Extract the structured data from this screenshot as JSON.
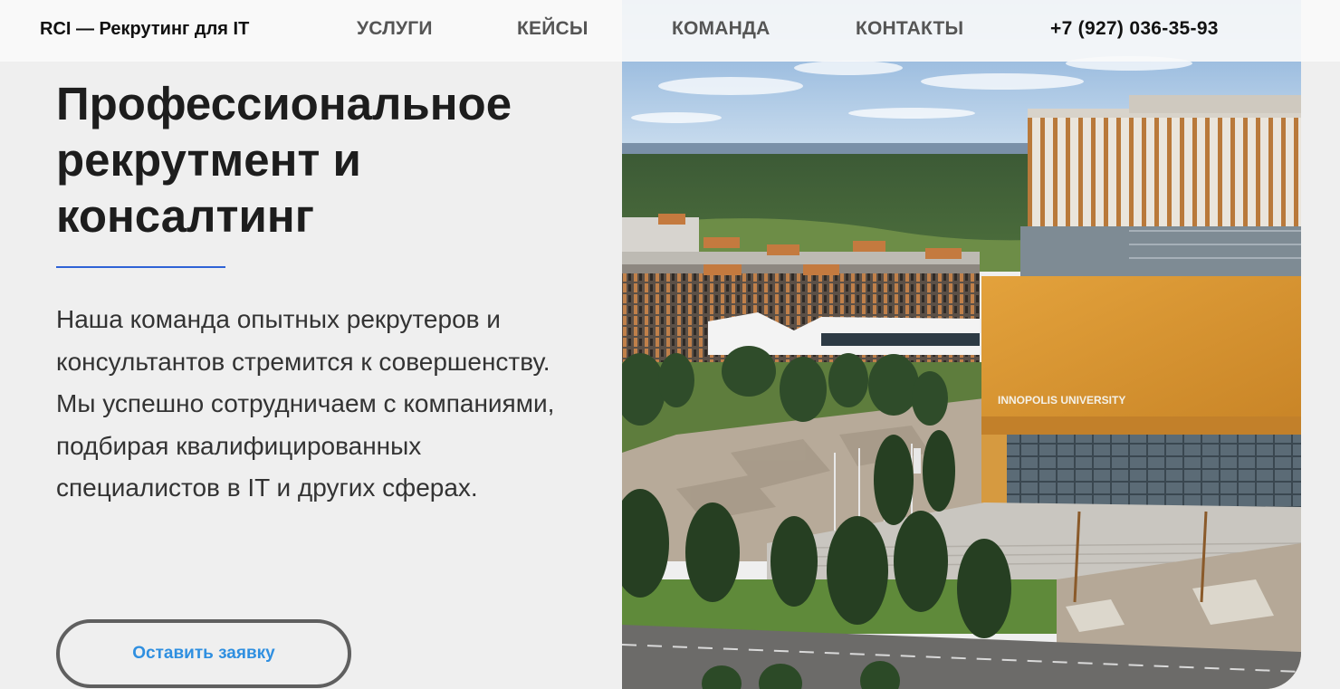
{
  "header": {
    "logo": "RCI — Рекрутинг для IT",
    "nav": {
      "services": "УСЛУГИ",
      "cases": "КЕЙСЫ",
      "team": "КОМАНДА",
      "contacts": "КОНТАКТЫ"
    },
    "phone": "+7 (927) 036-35-93"
  },
  "hero": {
    "title": "Профессиональное рекрутмент и консалтинг",
    "description": "Наша команда опытных рекрутеров и консультантов стремится к совершенству. Мы успешно сотрудничаем с компаниями, подбирая квалифицированных специалистов в IT и других сферах.",
    "cta_label": "Оставить заявку"
  },
  "photo": {
    "sign_text": "INNOPOLIS UNIVERSITY"
  },
  "colors": {
    "accent_line": "#2f63d6",
    "cta_text": "#2f8fe0",
    "background": "#efefef"
  }
}
